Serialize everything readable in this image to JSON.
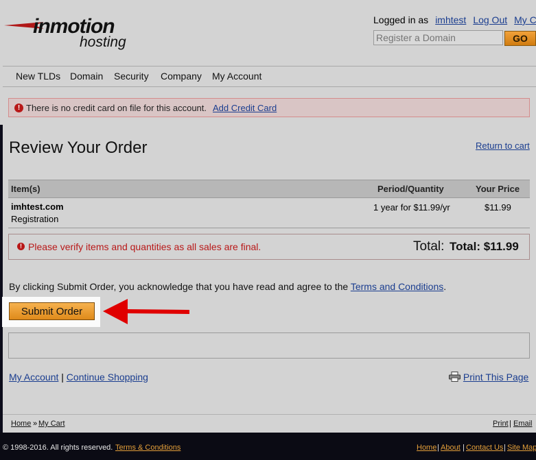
{
  "logo": {
    "word1": "inmotion",
    "word2": "hosting",
    "reg": "."
  },
  "userbar": {
    "logged_in_as": "Logged in as",
    "username": "imhtest",
    "logout": "Log Out",
    "cart": "My Cart"
  },
  "domain_search": {
    "placeholder": "Register a Domain",
    "go_label": "GO"
  },
  "nav": {
    "items": [
      "New TLDs",
      "Domain",
      "Security",
      "Company",
      "My Account"
    ]
  },
  "alert": {
    "text": "There is no credit card on file for this account.",
    "link": "Add Credit Card"
  },
  "page": {
    "title": "Review Your Order",
    "return_link": "Return to cart"
  },
  "order": {
    "headers": {
      "item": "Item(s)",
      "period": "Period/Quantity",
      "price": "Your Price"
    },
    "rows": [
      {
        "name": "imhtest.com",
        "type": "Registration",
        "period": "1 year for $11.99/yr",
        "price": "$11.99"
      }
    ],
    "verify_text": "Please verify items and quantities as all sales are final.",
    "total_label": "Total:",
    "total_value": "Total: $11.99"
  },
  "agreement": {
    "text": "By clicking Submit Order, you acknowledge that you have read and agree to the",
    "link": "Terms and Conditions",
    "end": "."
  },
  "submit_label": "Submit Order",
  "links": {
    "my_account": "My Account",
    "separator": "|",
    "continue": "Continue Shopping",
    "print": "Print This Page"
  },
  "breadcrumb": {
    "home": "Home",
    "sep": "»",
    "cart": "My Cart",
    "print": "Print",
    "pipe": "|",
    "email": "Email"
  },
  "footer": {
    "copyright": "© 1998-2016. All rights reserved.",
    "terms": "Terms & Conditions",
    "links": [
      "Home",
      "About",
      "Contact Us",
      "Site Map"
    ],
    "pipe": "|"
  },
  "colors": {
    "accent": "#e5962a",
    "alert_red": "#b81818",
    "link": "#1a3d8f",
    "arrow": "#e00000"
  },
  "icons": {
    "warning": "exclamation-circle-icon",
    "printer": "printer-icon",
    "arrow": "red-arrow"
  }
}
